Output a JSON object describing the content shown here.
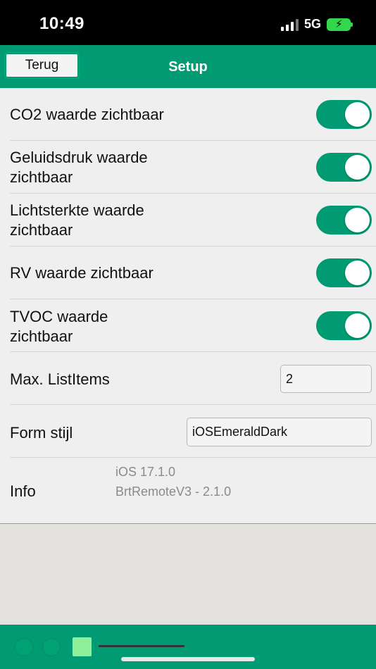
{
  "status_bar": {
    "time": "10:49",
    "network": "5G"
  },
  "nav": {
    "back_label": "Terug",
    "title": "Setup"
  },
  "settings": [
    {
      "label": "CO2 waarde zichtbaar",
      "on": true
    },
    {
      "label": "Geluidsdruk waarde zichtbaar",
      "on": true
    },
    {
      "label": "Lichtsterkte waarde zichtbaar",
      "on": true
    },
    {
      "label": "RV waarde zichtbaar",
      "on": true
    },
    {
      "label": "TVOC waarde zichtbaar",
      "on": true
    }
  ],
  "max_list_items": {
    "label": "Max. ListItems",
    "value": "2"
  },
  "form_style": {
    "label": "Form stijl",
    "value": "iOSEmeraldDark"
  },
  "info": {
    "label": "Info",
    "lines": [
      "iOS 17.1.0",
      "BrtRemoteV3 - 2.1.0"
    ]
  },
  "colors": {
    "accent": "#009b73",
    "status_bar": "#000000",
    "content_bg": "#efefef",
    "muted_text": "#8a8a8a"
  }
}
